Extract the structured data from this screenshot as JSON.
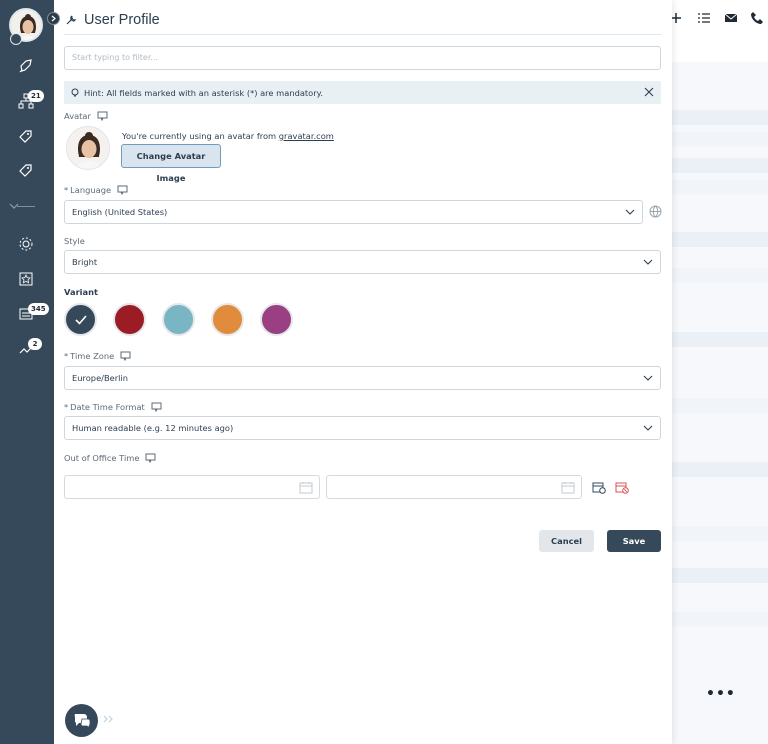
{
  "sidebar": {
    "avatar_alt": "user avatar",
    "badges": {
      "tickets": "21",
      "notifications": "345",
      "reminders": "2"
    }
  },
  "header": {
    "title": "User Profile"
  },
  "filter": {
    "placeholder": "Start typing to filter..."
  },
  "hint": {
    "text": "Hint: All fields marked with an asterisk (*) are mandatory."
  },
  "avatar": {
    "label": "Avatar",
    "description_prefix": "You're currently using an avatar from ",
    "link": "gravatar.com",
    "button": "Change Avatar Image"
  },
  "language": {
    "required": "*",
    "label": "Language",
    "value": "English (United States)"
  },
  "style": {
    "label": "Style",
    "value": "Bright"
  },
  "variant": {
    "label": "Variant",
    "options": [
      {
        "name": "dark-blue",
        "color": "#36495a",
        "selected": true
      },
      {
        "name": "dark-red",
        "color": "#9b1c24"
      },
      {
        "name": "light-blue",
        "color": "#79b5c3"
      },
      {
        "name": "orange",
        "color": "#e08c3c"
      },
      {
        "name": "purple",
        "color": "#9a3f82"
      }
    ]
  },
  "timezone": {
    "required": "*",
    "label": "Time Zone",
    "value": "Europe/Berlin"
  },
  "datetime_format": {
    "required": "*",
    "label": "Date Time Format",
    "value": "Human readable (e.g. 12 minutes ago)"
  },
  "out_of_office": {
    "label": "Out of Office Time"
  },
  "actions": {
    "cancel": "Cancel",
    "save": "Save"
  }
}
